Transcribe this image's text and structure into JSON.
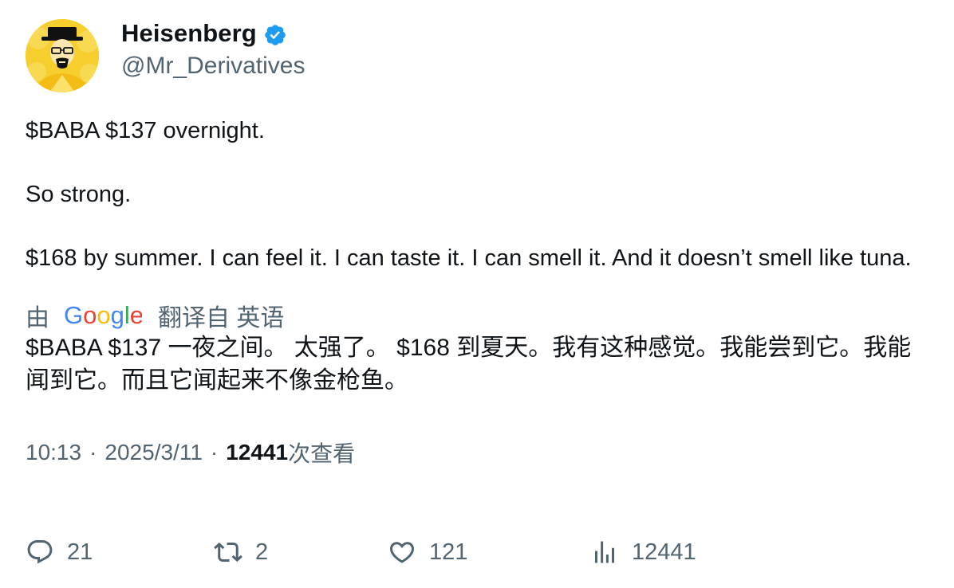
{
  "author": {
    "display_name": "Heisenberg",
    "handle": "@Mr_Derivatives",
    "verified": true
  },
  "tweet": {
    "paragraphs": [
      "$BABA $137 overnight.",
      "So strong.",
      "$168 by summer. I can feel it. I can taste it. I can smell it. And it doesn’t smell like tuna."
    ]
  },
  "translation": {
    "prefix": "由",
    "provider": "Google",
    "suffix": "翻译自 英语",
    "text": "$BABA $137 一夜之间。 太强了。 $168 到夏天。我有这种感觉。我能尝到它。我能闻到它。而且它闻起来不像金枪鱼。"
  },
  "meta": {
    "time": "10:13",
    "separator": "·",
    "date": "2025/3/11",
    "views_count": "12441",
    "views_label": "次查看"
  },
  "actions": {
    "replies": "21",
    "reposts": "2",
    "likes": "121",
    "views": "12441"
  },
  "icons": {
    "reply": "reply-icon",
    "repost": "repost-icon",
    "like": "heart-icon",
    "views": "bar-chart-icon",
    "verified": "verified-badge-icon"
  },
  "colors": {
    "verified_blue": "#1d9bf0",
    "secondary_text": "#536471",
    "primary_text": "#0f1419",
    "avatar_bg": "#f6cf2e"
  }
}
